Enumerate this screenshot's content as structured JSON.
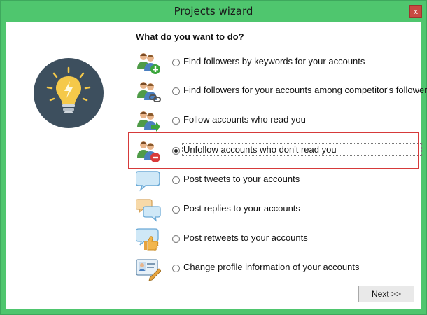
{
  "window": {
    "title": "Projects wizard",
    "close_glyph": "x"
  },
  "heading": "What do you want to do?",
  "options": [
    {
      "label": "Find followers by keywords for your accounts",
      "icon": "users-add-icon",
      "checked": false
    },
    {
      "label": "Find followers for your accounts among competitor's followers",
      "icon": "users-link-icon",
      "checked": false
    },
    {
      "label": "Follow accounts who read you",
      "icon": "users-follow-icon",
      "checked": false
    },
    {
      "label": "Unfollow accounts who don't read you",
      "icon": "users-remove-icon",
      "checked": true
    },
    {
      "label": "Post tweets to your accounts",
      "icon": "speech-bubble-icon",
      "checked": false
    },
    {
      "label": "Post replies to your accounts",
      "icon": "speech-bubbles-icon",
      "checked": false
    },
    {
      "label": "Post retweets to your accounts",
      "icon": "speech-thumbs-up-icon",
      "checked": false
    },
    {
      "label": "Change profile information of your accounts",
      "icon": "profile-card-icon",
      "checked": false
    }
  ],
  "next_button": "Next >>",
  "colors": {
    "titlebar": "#4fc66e",
    "highlight": "#d63a3a",
    "bulb_bg": "#3d4f5e",
    "bulb": "#f5c94a"
  }
}
